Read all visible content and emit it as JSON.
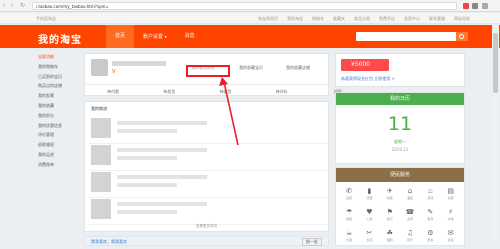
{
  "browser": {
    "url": "i.taobao.com/my_taobao.htm?spm="
  },
  "topbar": {
    "left": "手机逛淘宝",
    "links": [
      "淘宝网首页",
      "我的淘宝",
      "购物车",
      "收藏夹",
      "商品分类",
      "免费开店",
      "卖家中心",
      "联系客服",
      "网站导航"
    ]
  },
  "header": {
    "logo": "我的淘宝",
    "tabs": [
      "首页",
      "账户设置",
      "消息"
    ],
    "settings_caret": "▾"
  },
  "leftnav": [
    "全部功能",
    "我的购物车",
    "已买到的宝贝",
    "购买过的店铺",
    "我的发票",
    "我的收藏",
    "我的积分",
    "我的优惠信息",
    "评价管理",
    "退款维权",
    "我的足迹",
    "消费账单"
  ],
  "profile": {
    "vip_badge": "V",
    "stats": [
      "我的收货地址",
      "我的收藏宝贝",
      "我的收藏店铺"
    ],
    "row": [
      "待付款",
      "待发货",
      "待收货",
      "待评价",
      "退款"
    ]
  },
  "logistics": {
    "title": "我的物流",
    "items": [
      {
        "chip": "确认收货"
      },
      {
        "chip": "确认收货"
      },
      {
        "chip": "确认收货"
      },
      {
        "chip": "确认收货"
      }
    ],
    "more": "查看更多物流"
  },
  "ad": {
    "cash": "¥5000",
    "text": "恭喜获得现金红包 立即使用 >"
  },
  "calendar": {
    "title": "我的日历",
    "day": "11",
    "sub": "星期一",
    "date": "2019.11"
  },
  "services": {
    "title": "便民服务",
    "items": [
      {
        "glyph": "✆",
        "label": "话费"
      },
      {
        "glyph": "▮",
        "label": "流量"
      },
      {
        "glyph": "✈",
        "label": "机票"
      },
      {
        "glyph": "⌂",
        "label": "酒店"
      },
      {
        "glyph": "♨",
        "label": "游戏"
      },
      {
        "glyph": "▤",
        "label": "彩票"
      },
      {
        "glyph": "☂",
        "label": "保险"
      },
      {
        "glyph": "♥",
        "label": "公益"
      },
      {
        "glyph": "⚑",
        "label": "旅行"
      },
      {
        "glyph": "☎",
        "label": "宽带"
      },
      {
        "glyph": "✎",
        "label": "教育"
      },
      {
        "glyph": "⚡",
        "label": "水电"
      },
      {
        "glyph": "☕",
        "label": "外卖"
      },
      {
        "glyph": "✂",
        "label": "生活"
      },
      {
        "glyph": "☘",
        "label": "理财"
      },
      {
        "glyph": "♫",
        "label": "音乐"
      },
      {
        "glyph": "⚙",
        "label": "更多"
      },
      {
        "glyph": "✉",
        "label": "快递"
      }
    ]
  },
  "bottom": {
    "left": "猜我喜欢，猜我喜欢",
    "right": "换一批"
  }
}
